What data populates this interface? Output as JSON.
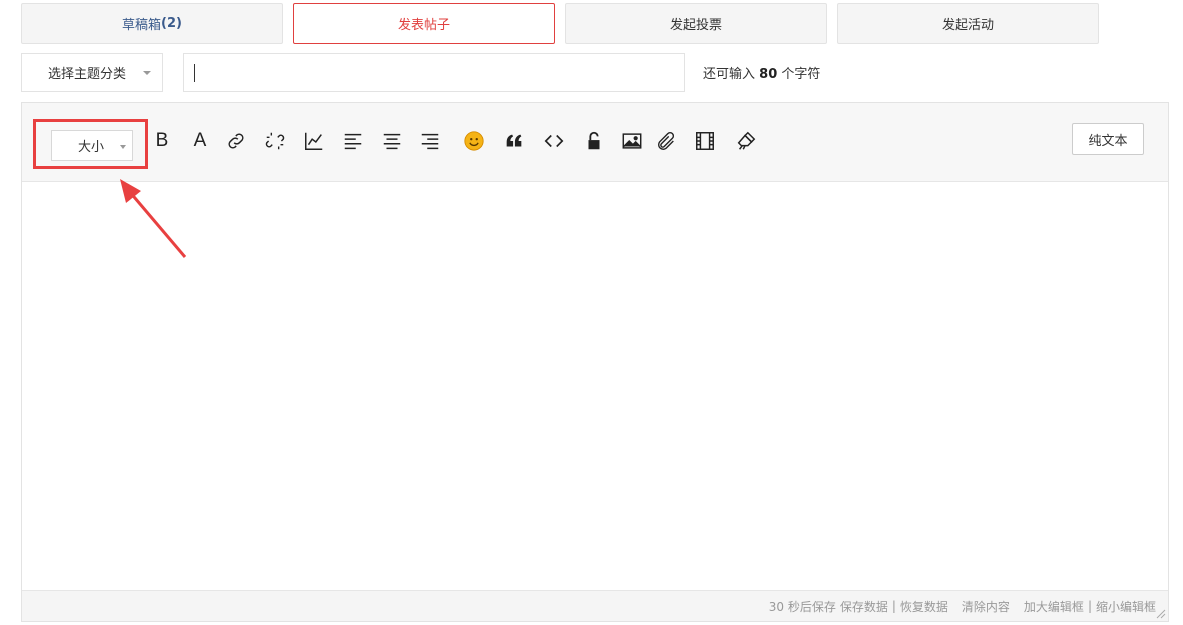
{
  "tabs": {
    "draft_prefix": "草稿箱",
    "draft_count": "(2)",
    "post": "发表帖子",
    "poll": "发起投票",
    "event": "发起活动"
  },
  "topic_select": {
    "label": "选择主题分类"
  },
  "title_input": {
    "value": ""
  },
  "hint": {
    "prefix": "还可输入",
    "count": "80",
    "suffix": "个字符"
  },
  "toolbar": {
    "size_label": "大小",
    "bold_glyph": "B",
    "font_color_glyph": "A",
    "plain_text_label": "纯文本",
    "icons": [
      "bold-icon",
      "font-color-icon",
      "link-icon",
      "unlink-icon",
      "chart-icon",
      "align-left-icon",
      "align-center-icon",
      "align-right-icon",
      "emoji-icon",
      "quote-icon",
      "code-icon",
      "lock-icon",
      "image-icon",
      "attachment-icon",
      "video-icon",
      "clear-format-icon"
    ]
  },
  "footer": {
    "autosave": "30 秒后保存",
    "save": "保存数据",
    "sep1": "|",
    "restore": "恢复数据",
    "clear": "清除内容",
    "enlarge": "加大编辑框",
    "sep2": "|",
    "shrink": "缩小编辑框"
  },
  "colors": {
    "accent": "#e0403f",
    "highlight_box": "#e84040",
    "draft_text": "#3b5b8c"
  }
}
